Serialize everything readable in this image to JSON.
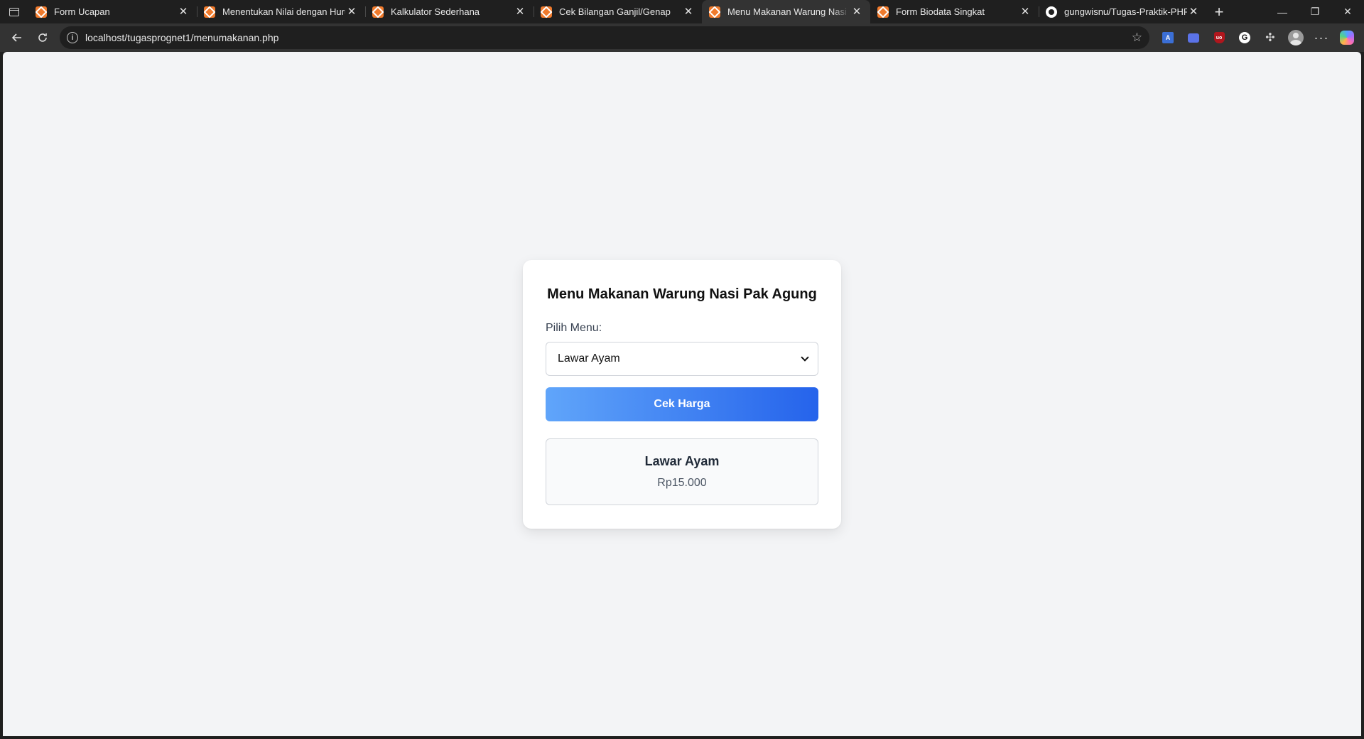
{
  "browser": {
    "tabs": [
      {
        "title": "Form Ucapan",
        "icon": "xampp-icon",
        "active": false
      },
      {
        "title": "Menentukan Nilai dengan Huruf",
        "icon": "xampp-icon",
        "active": false
      },
      {
        "title": "Kalkulator Sederhana",
        "icon": "xampp-icon",
        "active": false
      },
      {
        "title": "Cek Bilangan Ganjil/Genap",
        "icon": "xampp-icon",
        "active": false
      },
      {
        "title": "Menu Makanan Warung Nasi Pak Agung",
        "icon": "xampp-icon",
        "active": true
      },
      {
        "title": "Form Biodata Singkat",
        "icon": "xampp-icon",
        "active": false
      },
      {
        "title": "gungwisnu/Tugas-Praktik-PHP-D",
        "icon": "github-icon",
        "active": false
      }
    ],
    "url": "localhost/tugasprognet1/menumakanan.php"
  },
  "page": {
    "title": "Menu Makanan Warung Nasi Pak Agung",
    "select_label": "Pilih Menu:",
    "selected_menu": "Lawar Ayam",
    "button_label": "Cek Harga",
    "result": {
      "name": "Lawar Ayam",
      "price": "Rp15.000"
    }
  },
  "colors": {
    "page_background": "#f3f4f6",
    "button_gradient_start": "#60a5fa",
    "button_gradient_end": "#2563eb",
    "tab_favicon": "#f07a2c"
  }
}
